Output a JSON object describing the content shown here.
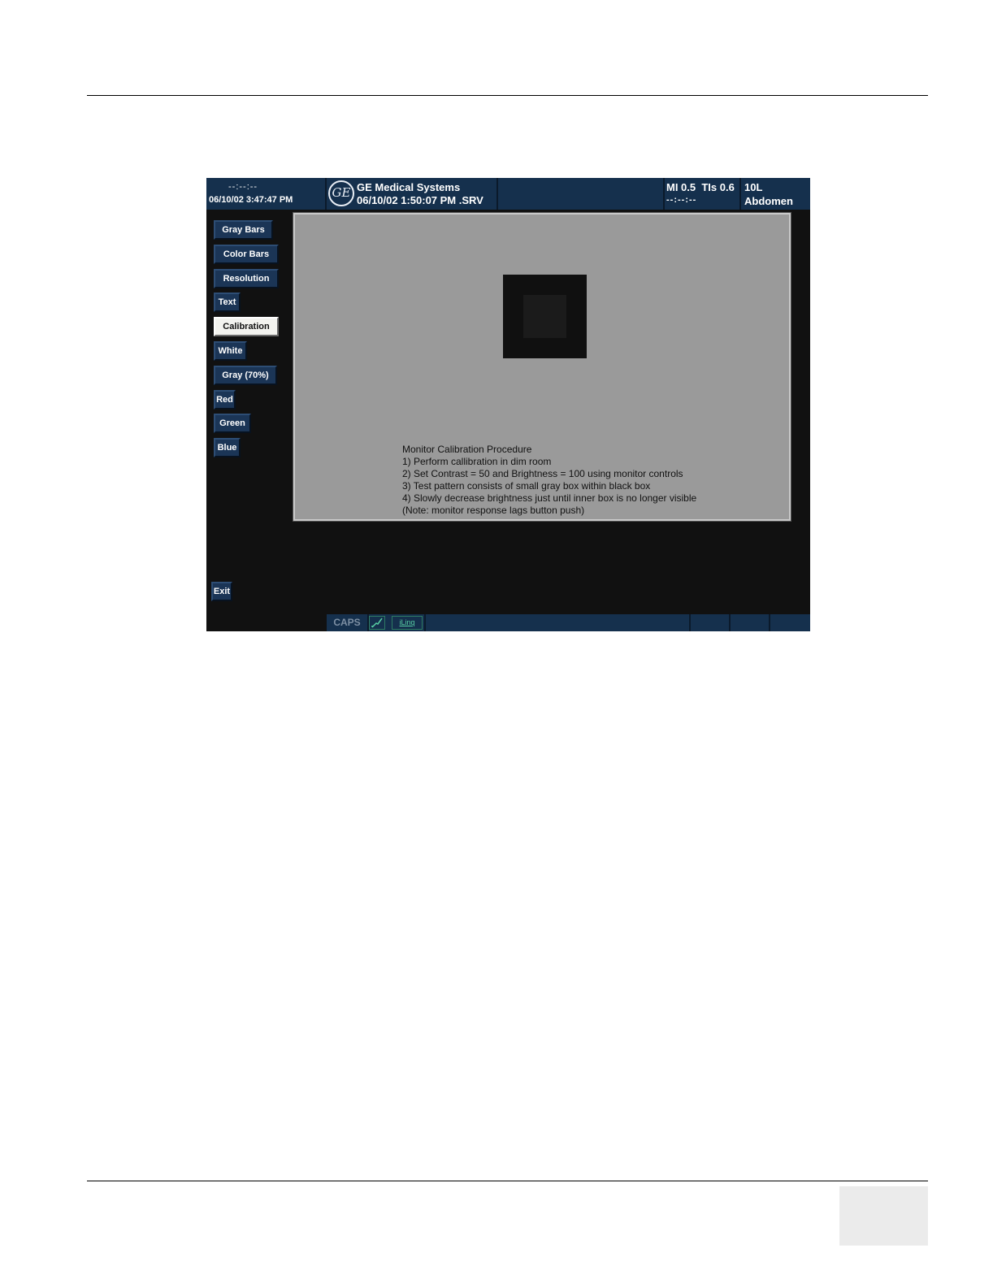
{
  "header": {
    "left_line1": "--:--:--",
    "left_line2": "06/10/02 3:47:47 PM",
    "logo_text": "GE",
    "company": "GE Medical Systems",
    "datetime": "06/10/02 1:50:07 PM  .SRV",
    "mi_tis": "MI 0.5  TIs 0.6",
    "mi_line2": "--:--:--",
    "probe": "10L",
    "preset": "Abdomen"
  },
  "sidebar": {
    "buttons": [
      {
        "label": "Gray Bars",
        "active": false
      },
      {
        "label": "Color Bars",
        "active": false
      },
      {
        "label": "Resolution",
        "active": false
      },
      {
        "label": "Text",
        "active": false
      },
      {
        "label": "Calibration",
        "active": true
      },
      {
        "label": "White",
        "active": false
      },
      {
        "label": "Gray (70%)",
        "active": false
      },
      {
        "label": "Red",
        "active": false
      },
      {
        "label": "Green",
        "active": false
      },
      {
        "label": "Blue",
        "active": false
      }
    ],
    "exit_label": "Exit"
  },
  "calibration": {
    "lines": [
      "Monitor Calibration Procedure",
      "1) Perform callibration in dim room",
      "2) Set Contrast = 50 and Brightness = 100 using monitor controls",
      "3) Test pattern consists of small gray box within black box",
      "4) Slowly decrease brightness just until inner box is no longer visible",
      "(Note: monitor response lags button push)"
    ]
  },
  "statusbar": {
    "caps": "CAPS",
    "icon1": "trackball-icon",
    "icon2_label": "iLinq"
  },
  "colors": {
    "bar_blue": "#15304d",
    "screen_bg": "#111111",
    "pattern_gray": "#9a9a9a"
  }
}
